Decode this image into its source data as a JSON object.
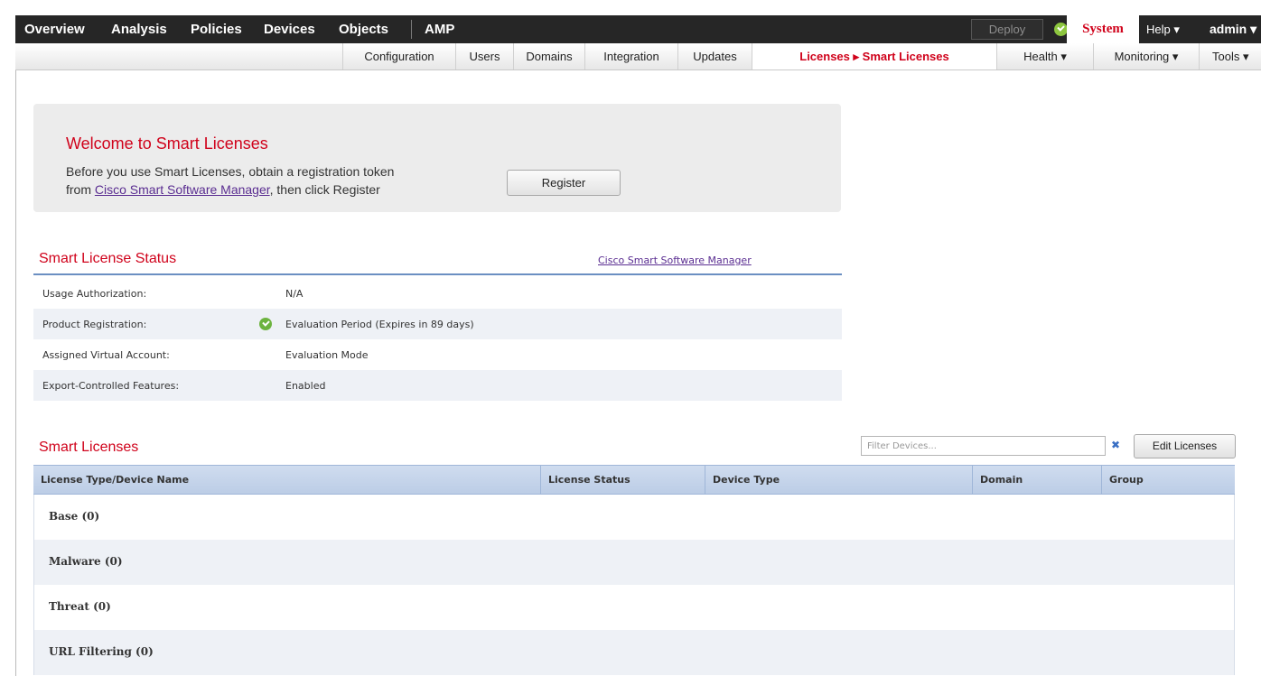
{
  "topnav": {
    "items": [
      "Overview",
      "Analysis",
      "Policies",
      "Devices",
      "Objects",
      "AMP"
    ],
    "deploy_label": "Deploy",
    "system_label": "System",
    "help_label": "Help ▾",
    "admin_label": "admin ▾"
  },
  "subnav": {
    "tabs": [
      "Configuration",
      "Users",
      "Domains",
      "Integration",
      "Updates",
      "Licenses ▸ Smart Licenses",
      "Health ▾",
      "Monitoring ▾",
      "Tools ▾"
    ]
  },
  "welcome": {
    "title": "Welcome to Smart Licenses",
    "line1": "Before you use Smart Licenses, obtain a registration token",
    "line2_prefix": "from ",
    "line2_link": "Cisco Smart Software Manager",
    "line2_suffix": ", then click Register",
    "register_label": "Register"
  },
  "status": {
    "title": "Smart License Status",
    "link": "Cisco Smart Software Manager",
    "rows": [
      {
        "label": "Usage Authorization:",
        "value": "N/A"
      },
      {
        "label": "Product Registration:",
        "value": "Evaluation Period (Expires in 89 days)"
      },
      {
        "label": "Assigned Virtual Account:",
        "value": "Evaluation Mode"
      },
      {
        "label": "Export-Controlled Features:",
        "value": "Enabled"
      }
    ]
  },
  "licenses": {
    "title": "Smart Licenses",
    "filter_placeholder": "Filter Devices...",
    "edit_label": "Edit Licenses",
    "columns": [
      "License Type/Device Name",
      "License Status",
      "Device Type",
      "Domain",
      "Group"
    ],
    "rows": [
      "Base (0)",
      "Malware (0)",
      "Threat (0)",
      "URL Filtering (0)"
    ]
  },
  "colors": {
    "accent_red": "#d0021b",
    "top_bar": "#262626",
    "header_blue": "#c4d3ea",
    "ok_green": "#6cb33f"
  }
}
